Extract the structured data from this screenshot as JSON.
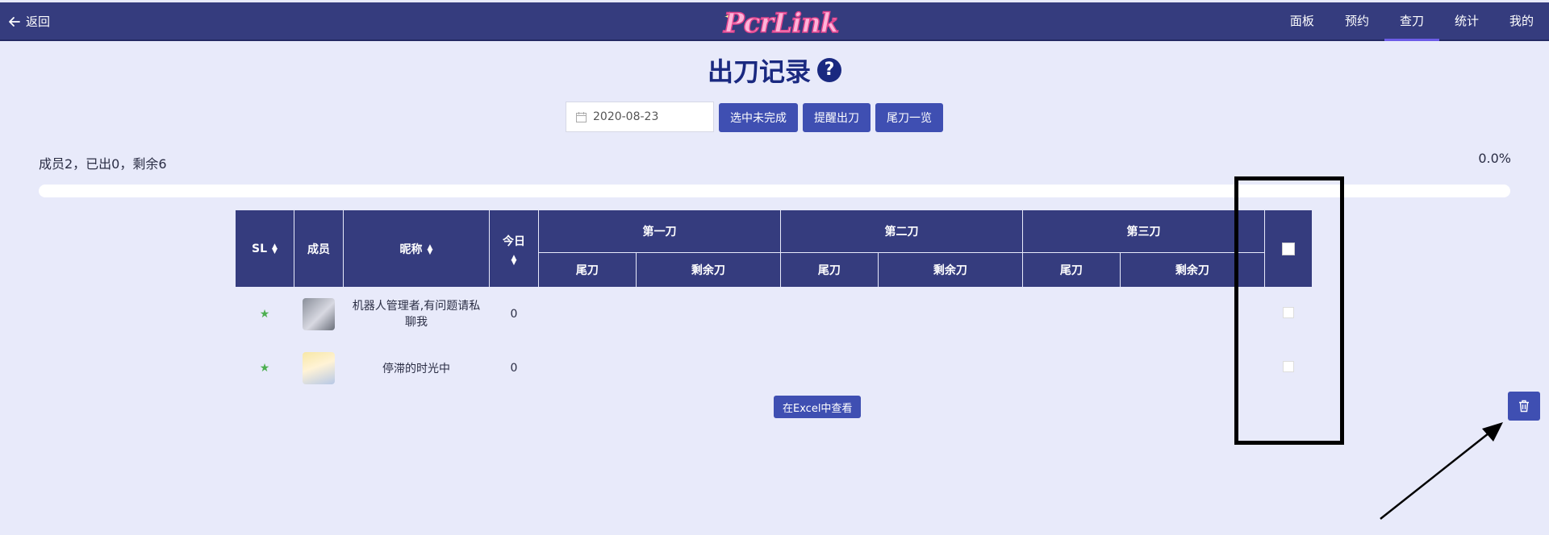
{
  "header": {
    "back_label": "返回",
    "logo_text": "PcrLink",
    "nav": [
      "面板",
      "预约",
      "查刀",
      "统计",
      "我的"
    ],
    "active_nav": 2
  },
  "title": "出刀记录",
  "help_glyph": "?",
  "toolbar": {
    "date_value": "2020-08-23",
    "select_unfinished": "选中未完成",
    "remind": "提醒出刀",
    "tail_list": "尾刀一览"
  },
  "stats": {
    "summary": "成员2，已出0，剩余6",
    "percent_text": "0.0%",
    "progress": 0.0
  },
  "table": {
    "headers": {
      "sl": "SL",
      "member": "成员",
      "nickname": "昵称",
      "today": "今日",
      "first": "第一刀",
      "second": "第二刀",
      "third": "第三刀",
      "tail": "尾刀",
      "remaining": "剩余刀"
    },
    "rows": [
      {
        "sl": "★",
        "nickname": "机器人管理者,有问题请私聊我",
        "today": "0"
      },
      {
        "sl": "★",
        "nickname": "停滞的时光中",
        "today": "0"
      }
    ]
  },
  "excel_button": "在Excel中查看",
  "colors": {
    "header_bg": "#353c7e",
    "button": "#3f4fb2",
    "page_bg": "#e8eafa",
    "title": "#1a2980",
    "star": "#4caf50"
  },
  "icons": [
    "arrow-left-icon",
    "help-icon",
    "calendar-icon",
    "sort-icon",
    "star-icon",
    "trash-icon"
  ]
}
